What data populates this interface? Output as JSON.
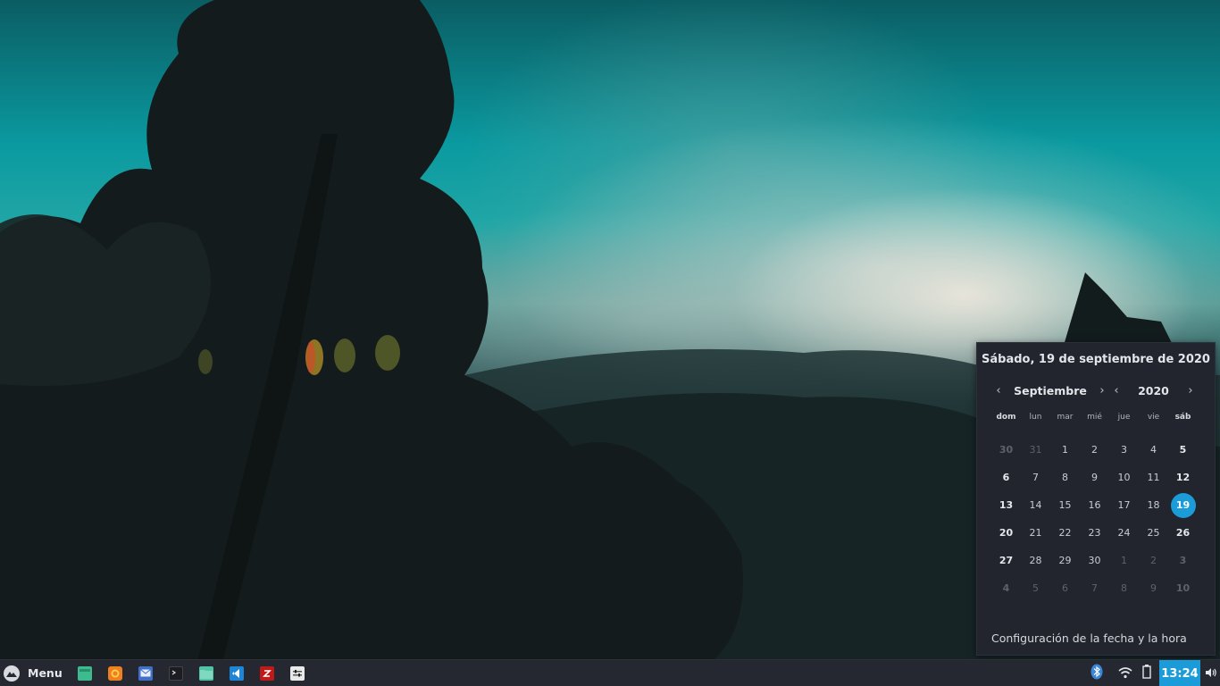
{
  "calendar": {
    "full_date": "Sábado, 19 de septiembre de 2020",
    "month": "Septiembre",
    "year": "2020",
    "weekdays": [
      "dom",
      "lun",
      "mar",
      "mié",
      "jue",
      "vie",
      "sáb"
    ],
    "weeks": [
      [
        "30",
        "31",
        "1",
        "2",
        "3",
        "4",
        "5"
      ],
      [
        "6",
        "7",
        "8",
        "9",
        "10",
        "11",
        "12"
      ],
      [
        "13",
        "14",
        "15",
        "16",
        "17",
        "18",
        "19"
      ],
      [
        "20",
        "21",
        "22",
        "23",
        "24",
        "25",
        "26"
      ],
      [
        "27",
        "28",
        "29",
        "30",
        "1",
        "2",
        "3"
      ],
      [
        "4",
        "5",
        "6",
        "7",
        "8",
        "9",
        "10"
      ]
    ],
    "today": "19",
    "settings_link": "Configuración de la fecha y la hora",
    "accent_color": "#1b9bd7"
  },
  "panel": {
    "menu_label": "Menu",
    "menu_icon": "mountain-logo-icon",
    "launchers": [
      {
        "name": "desktop-icon",
        "color": "#3dbb8e"
      },
      {
        "name": "firefox-icon",
        "color": "#f07f22"
      },
      {
        "name": "mail-icon",
        "color": "#3f6fc9"
      },
      {
        "name": "terminal-icon",
        "color": "#1b1d22"
      },
      {
        "name": "files-icon",
        "color": "#50c5a5"
      },
      {
        "name": "vscode-icon",
        "color": "#1f85d6"
      },
      {
        "name": "filezilla-icon",
        "color": "#bf1a1a"
      },
      {
        "name": "settings-icon",
        "color": "#e9e9ea"
      }
    ],
    "tray_icons": [
      "bluetooth-icon",
      "wifi-icon",
      "battery-icon"
    ],
    "clock": "13:24",
    "volume_icon": "volume-icon"
  }
}
